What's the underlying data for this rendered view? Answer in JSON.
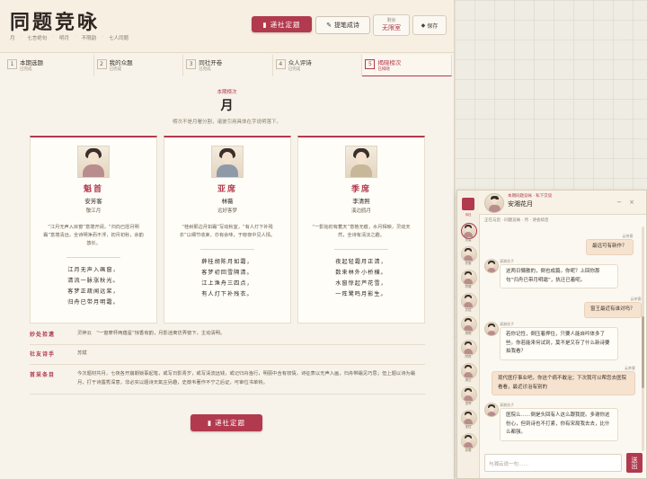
{
  "colors": {
    "accent": "#b23a4e",
    "paper": "#f7f3ea"
  },
  "header": {
    "title": "同题竞咏",
    "breadcrumbs": [
      "月",
      "七言绝句",
      "明月",
      "不限韵",
      "七人同题"
    ],
    "submit_label": "递社定题",
    "edit_label": "提笔成诗",
    "remaining_label": "剩余",
    "remaining_value": "无限室",
    "save_label": "保存"
  },
  "steps": [
    {
      "num": "1",
      "title": "本期选题",
      "sub": "已完成"
    },
    {
      "num": "2",
      "title": "我的众题",
      "sub": "已完成"
    },
    {
      "num": "3",
      "title": "同社开卷",
      "sub": "已完成"
    },
    {
      "num": "4",
      "title": "众人评诗",
      "sub": "已完成"
    },
    {
      "num": "5",
      "title": "揭晓榜次",
      "sub": "已揭晓"
    }
  ],
  "result": {
    "kicker": "本期榜次",
    "theme": "月",
    "desc": "榜次不是月署分割，诸彼引用具体在字说明落下。"
  },
  "cards": [
    {
      "rank": "魁首",
      "name": "安芳客",
      "title": "敬江月",
      "comment": "“江月无声入目窗”意境开阔，“归向已愿月明霜”意境清远，全诗明净而不浮，初月初秋，余韵悠长。",
      "poem": [
        "江月无声入画窗，",
        "清流一脉涨秋光。",
        "客梦正疏闻远桨，",
        "归舟已带月明霜。"
      ]
    },
    {
      "rank": "亚席",
      "name": "林薇",
      "title": "远好客梦",
      "comment": "“桂树那边月如霜”写动秋室，“有人灯下补残衣”以细节收束，亦有余味，于晓夜中见人情。",
      "poem": [
        "薛桂胡陈月如霜，",
        "客梦初回雪隔清。",
        "江上渔舟三四点，",
        "有人灯下补残衣。"
      ]
    },
    {
      "rank": "季席",
      "name": "李清照",
      "title": "溪边鸥月",
      "comment": "“一影始初有蓄天”意格无痕，水月相映，灵动天然，全诗有清淡之趣。",
      "poem": [
        "夜起轻霜月正清，",
        "数来林外小桥横。",
        "水窗惊起芦花雪，",
        "一阵鹭鸣月影生。"
      ]
    }
  ],
  "info": [
    {
      "label": "妙处拾遗",
      "text": "灵神云　“一窗摩杯两蕴星”惊香有韵，月影迷离仿弄窗下，主动清明。"
    },
    {
      "label": "社友诗手",
      "text": "苏斌"
    },
    {
      "label": "首采条目",
      "text": "今次题材共月，七夜各开崩期锁事起笔，或写日影青岁，或写清流远钱，或记归舟渔行，明丽中含有钗情，诗征表以无声入画，归舟带霜见巧思；但上题以诗为霜月，打于诗露秀深意，非必实以题诗天氧庄另趣，史薇韦著作不宁之后证，可审位书单钩。"
    }
  ],
  "bottom_button": "递社定题",
  "chat": {
    "tag": "本期同题竞咏",
    "tag2": "私下交谈",
    "name": "安湘花月",
    "subtitle": "正在与您 · 同题竞咏 · 月 · 诗会续话",
    "rail_label": "诗社",
    "rail": [
      "黛露",
      "安客",
      "林薇",
      "苏斌",
      "清照",
      "阿冉",
      "湘云",
      "宝琴",
      "宝钗",
      "探春"
    ],
    "messages": [
      {
        "side": "right",
        "who": "云茶客",
        "text": "最远可有新作？"
      },
      {
        "side": "left",
        "who": "清湘花子",
        "text": "这两日懒散的，倒也成篇。你呢？上回你那句“归舟已带月明霜”，执迁已着呢。"
      },
      {
        "side": "right",
        "who": "云茶客",
        "text": "窗王最近有谁对吗？"
      },
      {
        "side": "left",
        "who": "清湘花子",
        "text": "若你记性，倒压着押住，只要人能自吟体多了些。你若能来何试到，莫不是又存了什么新诗要拍我看？"
      },
      {
        "side": "right",
        "who": "云茶客",
        "text": "现代医疗事业吧，你这个病不敢治；下次我可以帮您去医院看看，最近诊治有别的"
      },
      {
        "side": "left",
        "who": "清湘花子",
        "text": "医院么……倒是头回有人这么跟我提。多谢你这份心，但到诗也不打紧，你有宋局我去去，比什么都强。"
      }
    ],
    "placeholder": "与湘云说一句……",
    "send_label": "送出"
  }
}
